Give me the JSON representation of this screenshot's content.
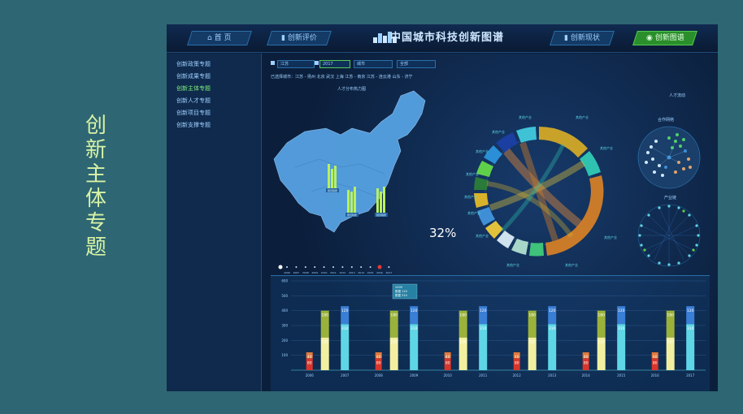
{
  "slide": {
    "title_chars": [
      "创",
      "新",
      "主",
      "体",
      "专",
      "题"
    ]
  },
  "app": {
    "title": "中国城市科技创新图谱"
  },
  "nav": [
    {
      "label": "首 页",
      "icon": "home-icon"
    },
    {
      "label": "创新评价",
      "icon": "chart-icon"
    },
    {
      "label": "创新现状",
      "icon": "chart-icon"
    },
    {
      "label": "创新图谱",
      "icon": "globe-icon"
    }
  ],
  "sidebar": {
    "items": [
      "创新政策专题",
      "创新成果专题",
      "创新主体专题",
      "创新人才专题",
      "创新项目专题",
      "创新支撑专题"
    ],
    "active": "创新主体专题"
  },
  "filters": {
    "province": "江苏",
    "year": "2017",
    "f3": "城市",
    "f4": "全部"
  },
  "cities": "已选择城市：江苏 - 扬州  北京  武汉  上海  江苏 - 南京  江苏 - 连云港  山东 - 济宁",
  "map_title": "人才分布热力图",
  "right_label": "人才流动",
  "network_labels": [
    "合作网络",
    "产业链"
  ],
  "map_badges": [
    "研究院所",
    "研究院所",
    "研究院所"
  ],
  "percent": "32%",
  "chord_labels": [
    "其他产业",
    "其他产业",
    "其他产业",
    "其他产业",
    "其他产业",
    "其他产业",
    "其他产业",
    "其他产业",
    "其他产业",
    "其他产业",
    "其他产业",
    "其他产业"
  ],
  "timeline": {
    "years": [
      "2006",
      "2007",
      "2008",
      "2009",
      "2010",
      "2011",
      "2012",
      "2013",
      "2014",
      "2015",
      "2016",
      "2017"
    ],
    "current": "2016"
  },
  "tooltip": {
    "lines": [
      "2009",
      "数据 120",
      "数据 310"
    ]
  },
  "chart_data": {
    "type": "bar",
    "title": "",
    "xlabel": "",
    "ylabel": "",
    "ylim": [
      0,
      600
    ],
    "yticks": [
      100,
      200,
      300,
      400,
      500,
      600
    ],
    "groups": [
      {
        "x": [
          "2006",
          "2007"
        ],
        "stack": [
          80,
          40,
          220,
          180
        ],
        "tall": [
          310,
          120
        ]
      },
      {
        "x": [
          "2008",
          "2009"
        ],
        "stack": [
          80,
          40,
          220,
          180
        ],
        "tall": [
          310,
          120
        ]
      },
      {
        "x": [
          "2010",
          "2011"
        ],
        "stack": [
          80,
          40,
          220,
          180
        ],
        "tall": [
          310,
          120
        ]
      },
      {
        "x": [
          "2012",
          "2013"
        ],
        "stack": [
          80,
          40,
          220,
          180
        ],
        "tall": [
          310,
          120
        ]
      },
      {
        "x": [
          "2014",
          "2015"
        ],
        "stack": [
          80,
          40,
          220,
          180
        ],
        "tall": [
          310,
          120
        ]
      },
      {
        "x": [
          "2016",
          "2017"
        ],
        "stack": [
          80,
          40,
          220,
          180
        ],
        "tall": [
          310,
          120
        ]
      }
    ],
    "colors": {
      "red": "#d9362b",
      "orange": "#e2793a",
      "yellow": "#f2f0a0",
      "olive": "#9bb23a",
      "cyan": "#5fd6e6",
      "blue": "#3a7fd6"
    }
  }
}
